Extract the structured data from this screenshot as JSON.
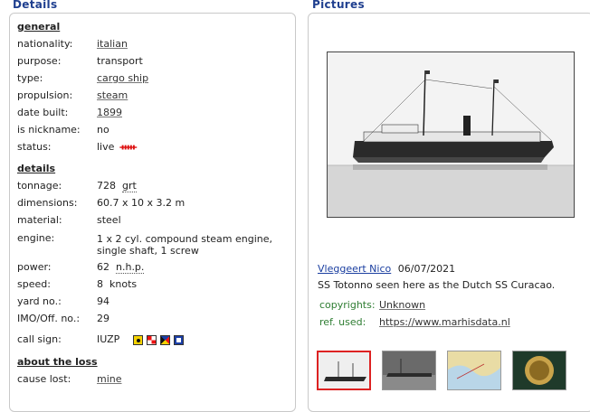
{
  "details": {
    "title": "Details",
    "general_head": "general",
    "general": [
      {
        "label": "nationality:",
        "value": "italian",
        "link": true
      },
      {
        "label": "purpose:",
        "value": "transport",
        "link": false
      },
      {
        "label": "type:",
        "value": "cargo ship",
        "link": true
      },
      {
        "label": "propulsion:",
        "value": "steam",
        "link": true
      },
      {
        "label": "date built:",
        "value": "1899",
        "link": true
      },
      {
        "label": "is nickname:",
        "value": "no",
        "link": false
      },
      {
        "label": "status:",
        "value": "live",
        "link": false
      }
    ],
    "details_head": "details",
    "specs": [
      {
        "label": "tonnage:",
        "value": "728",
        "unit": "grt"
      },
      {
        "label": "dimensions:",
        "value": "60.7 x 10 x 3.2 m"
      },
      {
        "label": "material:",
        "value": "steel"
      },
      {
        "label": "engine:",
        "value": "1 x 2 cyl. compound steam engine, single shaft, 1 screw"
      },
      {
        "label": "power:",
        "value": "62",
        "unit": "n.h.p."
      },
      {
        "label": "speed:",
        "value": "8  knots"
      },
      {
        "label": "yard no.:",
        "value": "94"
      },
      {
        "label": "IMO/Off. no.:",
        "value": "29"
      },
      {
        "label": "call sign:",
        "value": "IUZP"
      }
    ],
    "call_sign_flags": [
      "I",
      "U",
      "Z",
      "P"
    ],
    "loss_head": "about the loss",
    "loss": [
      {
        "label": "cause lost:",
        "value": "mine",
        "link": true
      }
    ]
  },
  "pictures": {
    "title": "Pictures",
    "author": "Vleggeert Nico",
    "date": "06/07/2021",
    "caption": "SS Totonno seen here as the Dutch SS Curacao.",
    "copyrights_label": "copyrights:",
    "copyrights_value": "Unknown",
    "ref_label": "ref. used:",
    "ref_value": "https://www.marhisdata.nl",
    "thumbnails": [
      "ship-photo-1",
      "ship-photo-2",
      "chart-map",
      "medal-seal"
    ]
  },
  "colors": {
    "accent": "#1f3f8f",
    "link": "#1a3ea0",
    "live": "#dd1111",
    "meta_label": "#2e7d32"
  }
}
